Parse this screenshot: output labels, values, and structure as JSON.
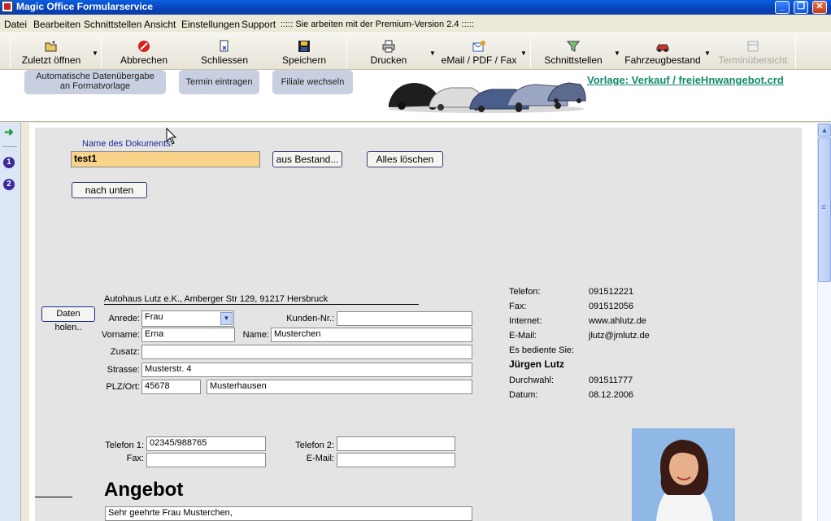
{
  "window": {
    "title": "Magic Office Formularservice",
    "btn_minimize": "_",
    "btn_maximize": "❐",
    "btn_close": "✕"
  },
  "menu": {
    "items": [
      "Datei",
      "Bearbeiten",
      "Schnittstellen",
      "Ansicht",
      "Einstellungen",
      "Support",
      "::::: Sie arbeiten mit der Premium-Version 2.4 :::::"
    ]
  },
  "toolbar": {
    "items": [
      {
        "label": "Zuletzt öffnen",
        "icon": "folder-open-icon"
      },
      {
        "label": "Abbrechen",
        "icon": "cancel-icon"
      },
      {
        "label": "Schliessen",
        "icon": "close-doc-icon"
      },
      {
        "label": "Speichern",
        "icon": "floppy-disk-icon"
      },
      {
        "label": "Drucken",
        "icon": "printer-icon"
      },
      {
        "label": "eMail / PDF / Fax",
        "icon": "email-pdf-icon"
      },
      {
        "label": "Schnittstellen",
        "icon": "funnel-icon"
      },
      {
        "label": "Fahrzeugbestand",
        "icon": "car-icon"
      },
      {
        "label": "Terminübersicht",
        "icon": "calendar-icon",
        "disabled": true
      }
    ],
    "dropdown_arrow": "▼"
  },
  "panel2": {
    "btn_auto_line1": "Automatische Datenübergabe",
    "btn_auto_line2": "an Formatvorlage",
    "btn_termin": "Termin eintragen",
    "btn_filiale": "Filiale wechseln",
    "vorlage_link": "Vorlage: Verkauf / freieHnwangebot.crd"
  },
  "leftstrip": {
    "arrow": "➜",
    "badge1": "1",
    "badge2": "2"
  },
  "form": {
    "doc_name_label": "Name des Dokuments:",
    "doc_name_value": "test1",
    "btn_aus_bestand": "aus Bestand...",
    "btn_alles_loeschen": "Alles löschen",
    "btn_nach_unten": "nach unten",
    "btn_daten_holen": "Daten holen..",
    "sender_line": "Autohaus Lutz e.K., Amberger Str 129, 91217 Hersbruck",
    "anrede_label": "Anrede:",
    "anrede_value": "Frau",
    "kunden_nr_label": "Kunden-Nr.:",
    "kunden_nr_value": "",
    "vorname_label": "Vorname:",
    "vorname_value": "Erna",
    "name_label": "Name:",
    "name_value": "Musterchen",
    "zusatz_label": "Zusatz:",
    "zusatz_value": "",
    "strasse_label": "Strasse:",
    "strasse_value": "Musterstr. 4",
    "plz_label": "PLZ/Ort:",
    "plz_value": "45678",
    "ort_value": "Musterhausen",
    "telefon1_label": "Telefon 1:",
    "telefon1_value": "02345/988765",
    "telefon2_label": "Telefon 2:",
    "telefon2_value": "",
    "fax_label": "Fax:",
    "fax_value": "",
    "email_label": "E-Mail:",
    "email_value": "",
    "angebot_heading": "Angebot",
    "salutation": "Sehr geehrte Frau Musterchen,"
  },
  "dealer_info": {
    "telefon_label": "Telefon:",
    "telefon_value": "091512221",
    "fax_label": "Fax:",
    "fax_value": "091512056",
    "internet_label": "Internet:",
    "internet_value": "www.ahlutz.de",
    "email_label": "E-Mail:",
    "email_value": "jlutz@jmlutz.de",
    "bedient_label": "Es bediente Sie:",
    "bedient_name": "Jürgen Lutz",
    "durchwahl_label": "Durchwahl:",
    "durchwahl_value": "091511777",
    "datum_label": "Datum:",
    "datum_value": "08.12.2006"
  },
  "scroll": {
    "up": "▲",
    "down": "▼",
    "grip": "≡"
  },
  "colors": {
    "accent_link": "#118a6a",
    "doc_name_bg": "#f9d38a",
    "titlebar": "#0842b8"
  }
}
